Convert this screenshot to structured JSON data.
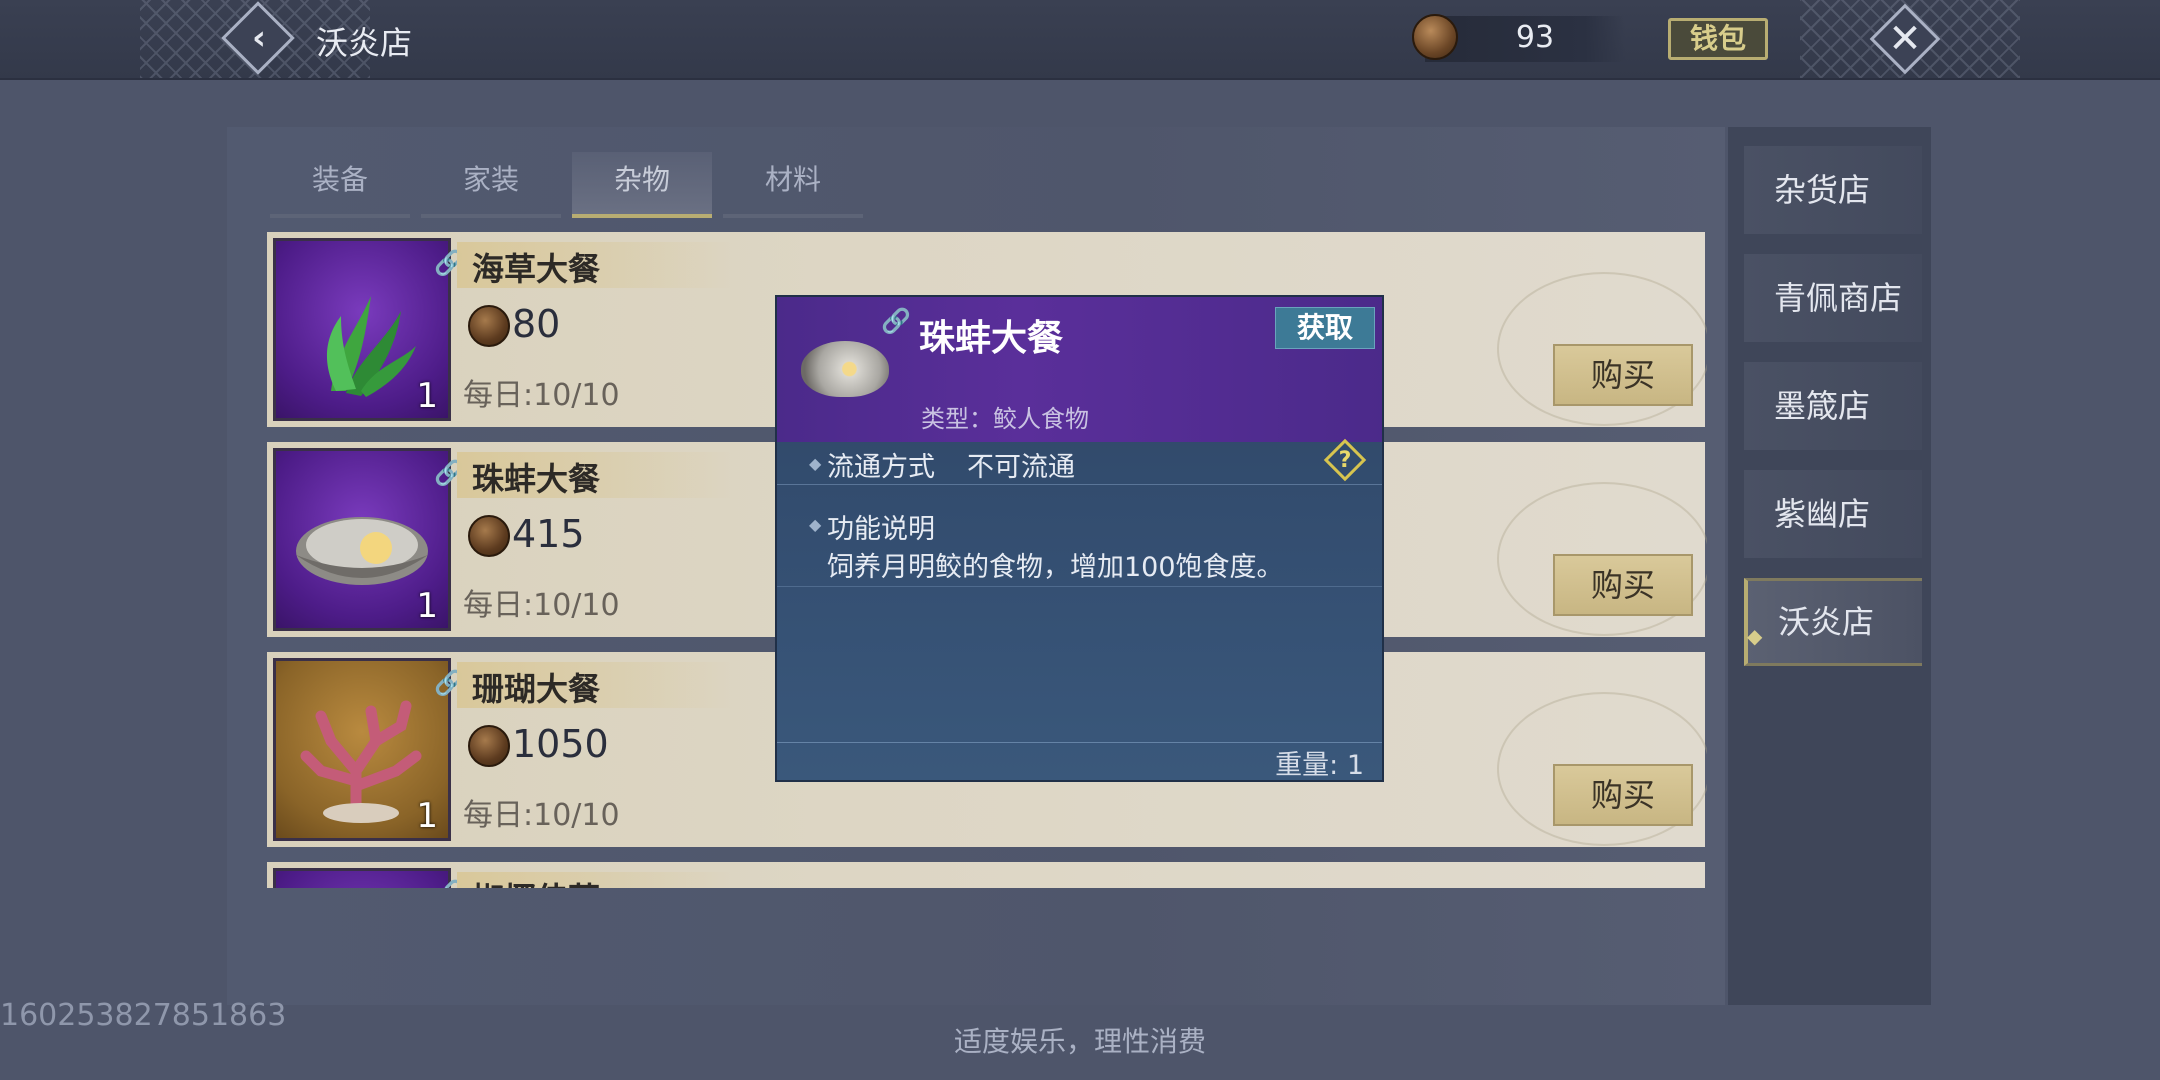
{
  "header": {
    "title": "沃炎店",
    "currency_amount": "93",
    "wallet_label": "钱包"
  },
  "tabs": [
    {
      "label": "装备",
      "active": false
    },
    {
      "label": "家装",
      "active": false
    },
    {
      "label": "杂物",
      "active": true
    },
    {
      "label": "材料",
      "active": false
    }
  ],
  "items": [
    {
      "name": "海草大餐",
      "price": "80",
      "quantity": "1",
      "daily_limit": "每日:10/10",
      "buy_label": "购买"
    },
    {
      "name": "珠蚌大餐",
      "price": "415",
      "quantity": "1",
      "daily_limit": "每日:10/10",
      "buy_label": "购买"
    },
    {
      "name": "珊瑚大餐",
      "price": "1050",
      "quantity": "1",
      "daily_limit": "每日:10/10",
      "buy_label": "购买"
    },
    {
      "name": "椒椰佳蔬"
    }
  ],
  "shops": [
    {
      "label": "杂货店",
      "active": false
    },
    {
      "label": "青佩商店",
      "active": false
    },
    {
      "label": "墨箴店",
      "active": false
    },
    {
      "label": "紫幽店",
      "active": false
    },
    {
      "label": "沃炎店",
      "active": true
    }
  ],
  "tooltip": {
    "title": "珠蚌大餐",
    "obtain_label": "获取",
    "type_text": "类型：鲛人食物",
    "circulation_label": "流通方式",
    "circulation_value": "不可流通",
    "function_label": "功能说明",
    "function_text": "饲养月明鲛的食物，增加100饱食度。",
    "weight_text": "重量: 1"
  },
  "watermark": "160253827851863",
  "footer_note": "适度娱乐，理性消费",
  "colors": {
    "accent_gold": "#b8ad72",
    "popup_header": "#5a2f9a",
    "obtain_button": "#3d7a96"
  },
  "icons": [
    "back-arrow-icon",
    "coin-icon",
    "close-icon",
    "link-icon",
    "help-icon",
    "seaweed-icon",
    "clam-icon",
    "coral-icon"
  ]
}
